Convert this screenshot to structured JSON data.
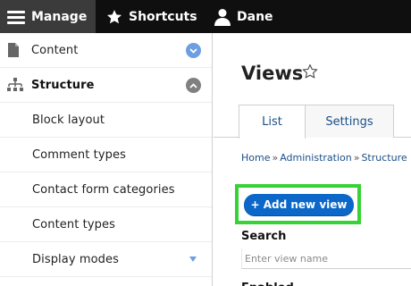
{
  "toolbar": {
    "manage_label": "Manage",
    "shortcuts_label": "Shortcuts",
    "user_label": "Dane"
  },
  "sidebar": {
    "items": [
      {
        "label": "Content",
        "icon": "document-icon",
        "toggle": "expand"
      },
      {
        "label": "Structure",
        "icon": "sitemap-icon",
        "toggle": "collapse"
      },
      {
        "label": "Block layout"
      },
      {
        "label": "Comment types"
      },
      {
        "label": "Contact form categories"
      },
      {
        "label": "Content types"
      },
      {
        "label": "Display modes",
        "caret": "down"
      }
    ]
  },
  "main": {
    "title": "Views",
    "tabs": [
      {
        "label": "List",
        "active": true
      },
      {
        "label": "Settings",
        "active": false
      }
    ],
    "breadcrumb": [
      "Home",
      "Administration",
      "Structure"
    ],
    "add_button_label": "+ Add new view",
    "search": {
      "label": "Search",
      "placeholder": "Enter view name"
    },
    "section_heading": "Enabled"
  },
  "colors": {
    "toolbar_bg": "#0f0f0f",
    "toolbar_active": "#3b3b3b",
    "link": "#1a4f88",
    "primary_button": "#0c68c8",
    "highlight_border": "#37d236",
    "toggle_blue": "#6d9ee0"
  }
}
